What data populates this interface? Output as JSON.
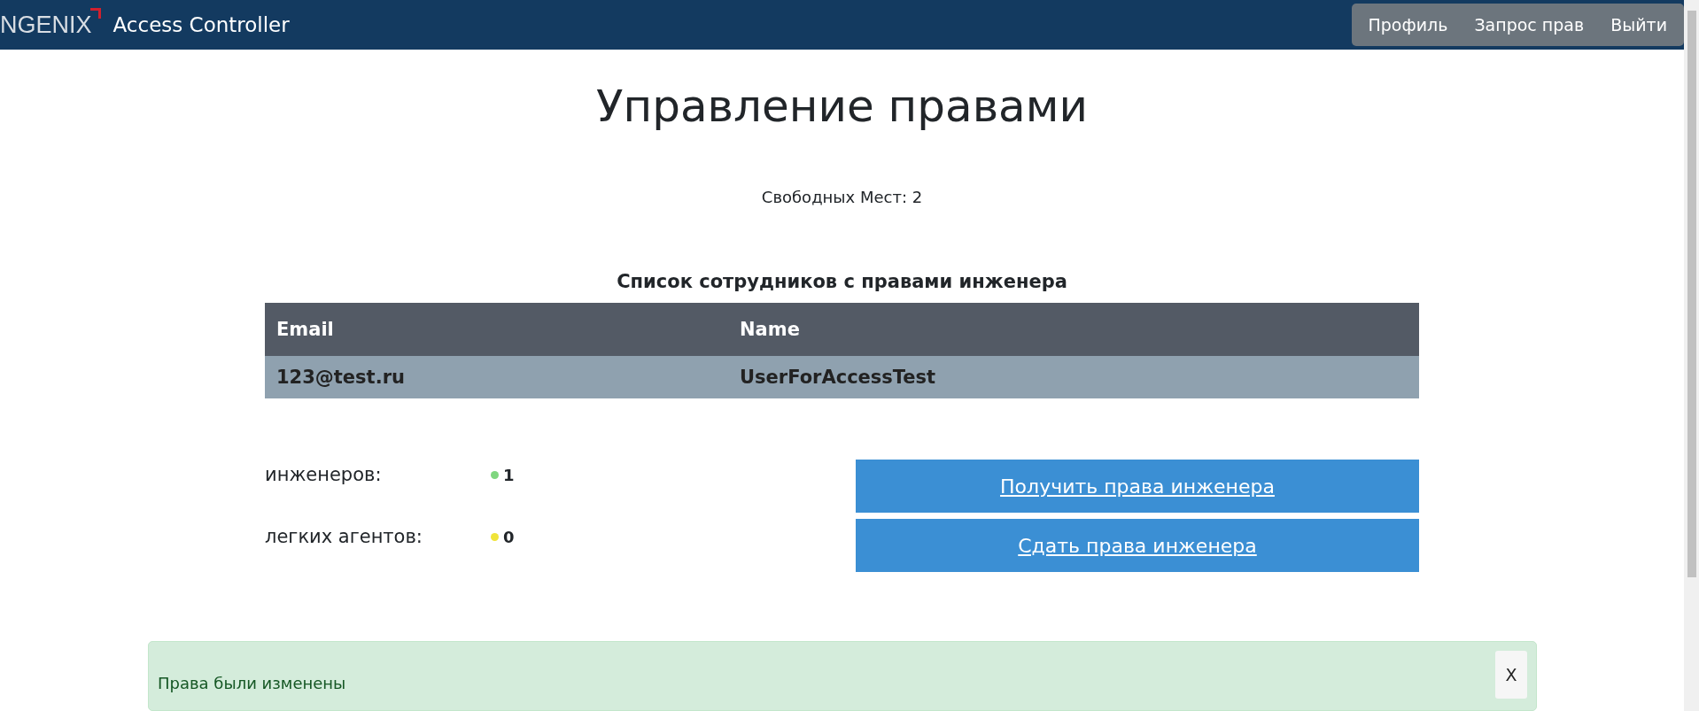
{
  "header": {
    "logo": "NGENIX",
    "title": "Access Controller",
    "nav": [
      {
        "label": "Профиль"
      },
      {
        "label": "Запрос прав"
      },
      {
        "label": "Выйти"
      }
    ]
  },
  "page_title": "Управление правами",
  "free_seats": "Свободных Мест: 2",
  "table": {
    "title": "Список сотрудников с правами инженера",
    "columns": [
      "Email",
      "Name"
    ],
    "rows": [
      [
        "123@test.ru",
        "UserForAccessTest"
      ]
    ]
  },
  "counters": [
    {
      "label": "инженеров:",
      "value": "1",
      "color": "#7fd67f"
    },
    {
      "label": "легких агентов:",
      "value": "0",
      "color": "#f0e43a"
    }
  ],
  "actions": [
    {
      "label": "Получить права инженера"
    },
    {
      "label": "Сдать права инженера"
    }
  ],
  "alert": {
    "message": "Права были изменены",
    "close": "X"
  }
}
